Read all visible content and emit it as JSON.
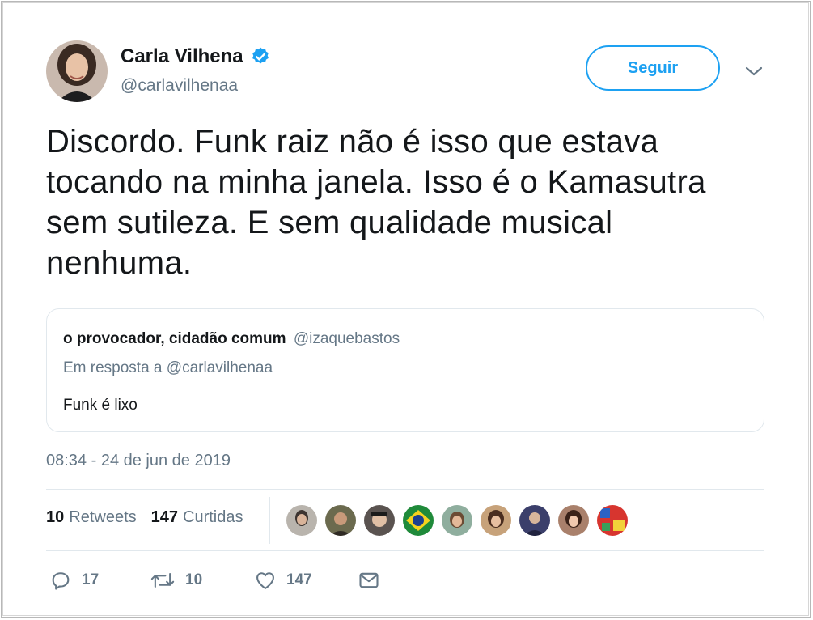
{
  "author": {
    "name": "Carla Vilhena",
    "handle": "@carlavilhenaa",
    "verified_icon": "verified-badge-icon"
  },
  "follow_button": {
    "label": "Seguir"
  },
  "tweet": {
    "lines": [
      "Discordo. Funk raiz não é isso que estava",
      "tocando na minha janela. Isso é o Kamasutra",
      "sem sutileza. E sem qualidade musical",
      "nenhuma."
    ]
  },
  "quoted": {
    "name": "o provocador, cidadão comum",
    "handle": "@izaquebastos",
    "reply_to": "Em resposta a @carlavilhenaa",
    "text": "Funk é lixo"
  },
  "timestamp": "08:34 - 24 de jun de 2019",
  "stats": {
    "retweets_count": "10",
    "retweets_label": "Retweets",
    "likes_count": "147",
    "likes_label": "Curtidas"
  },
  "actions": {
    "reply_count": "17",
    "retweet_count": "10",
    "like_count": "147"
  },
  "colors": {
    "accent": "#1da1f2",
    "muted": "#657786",
    "text": "#14171a",
    "border": "#e1e8ed"
  }
}
